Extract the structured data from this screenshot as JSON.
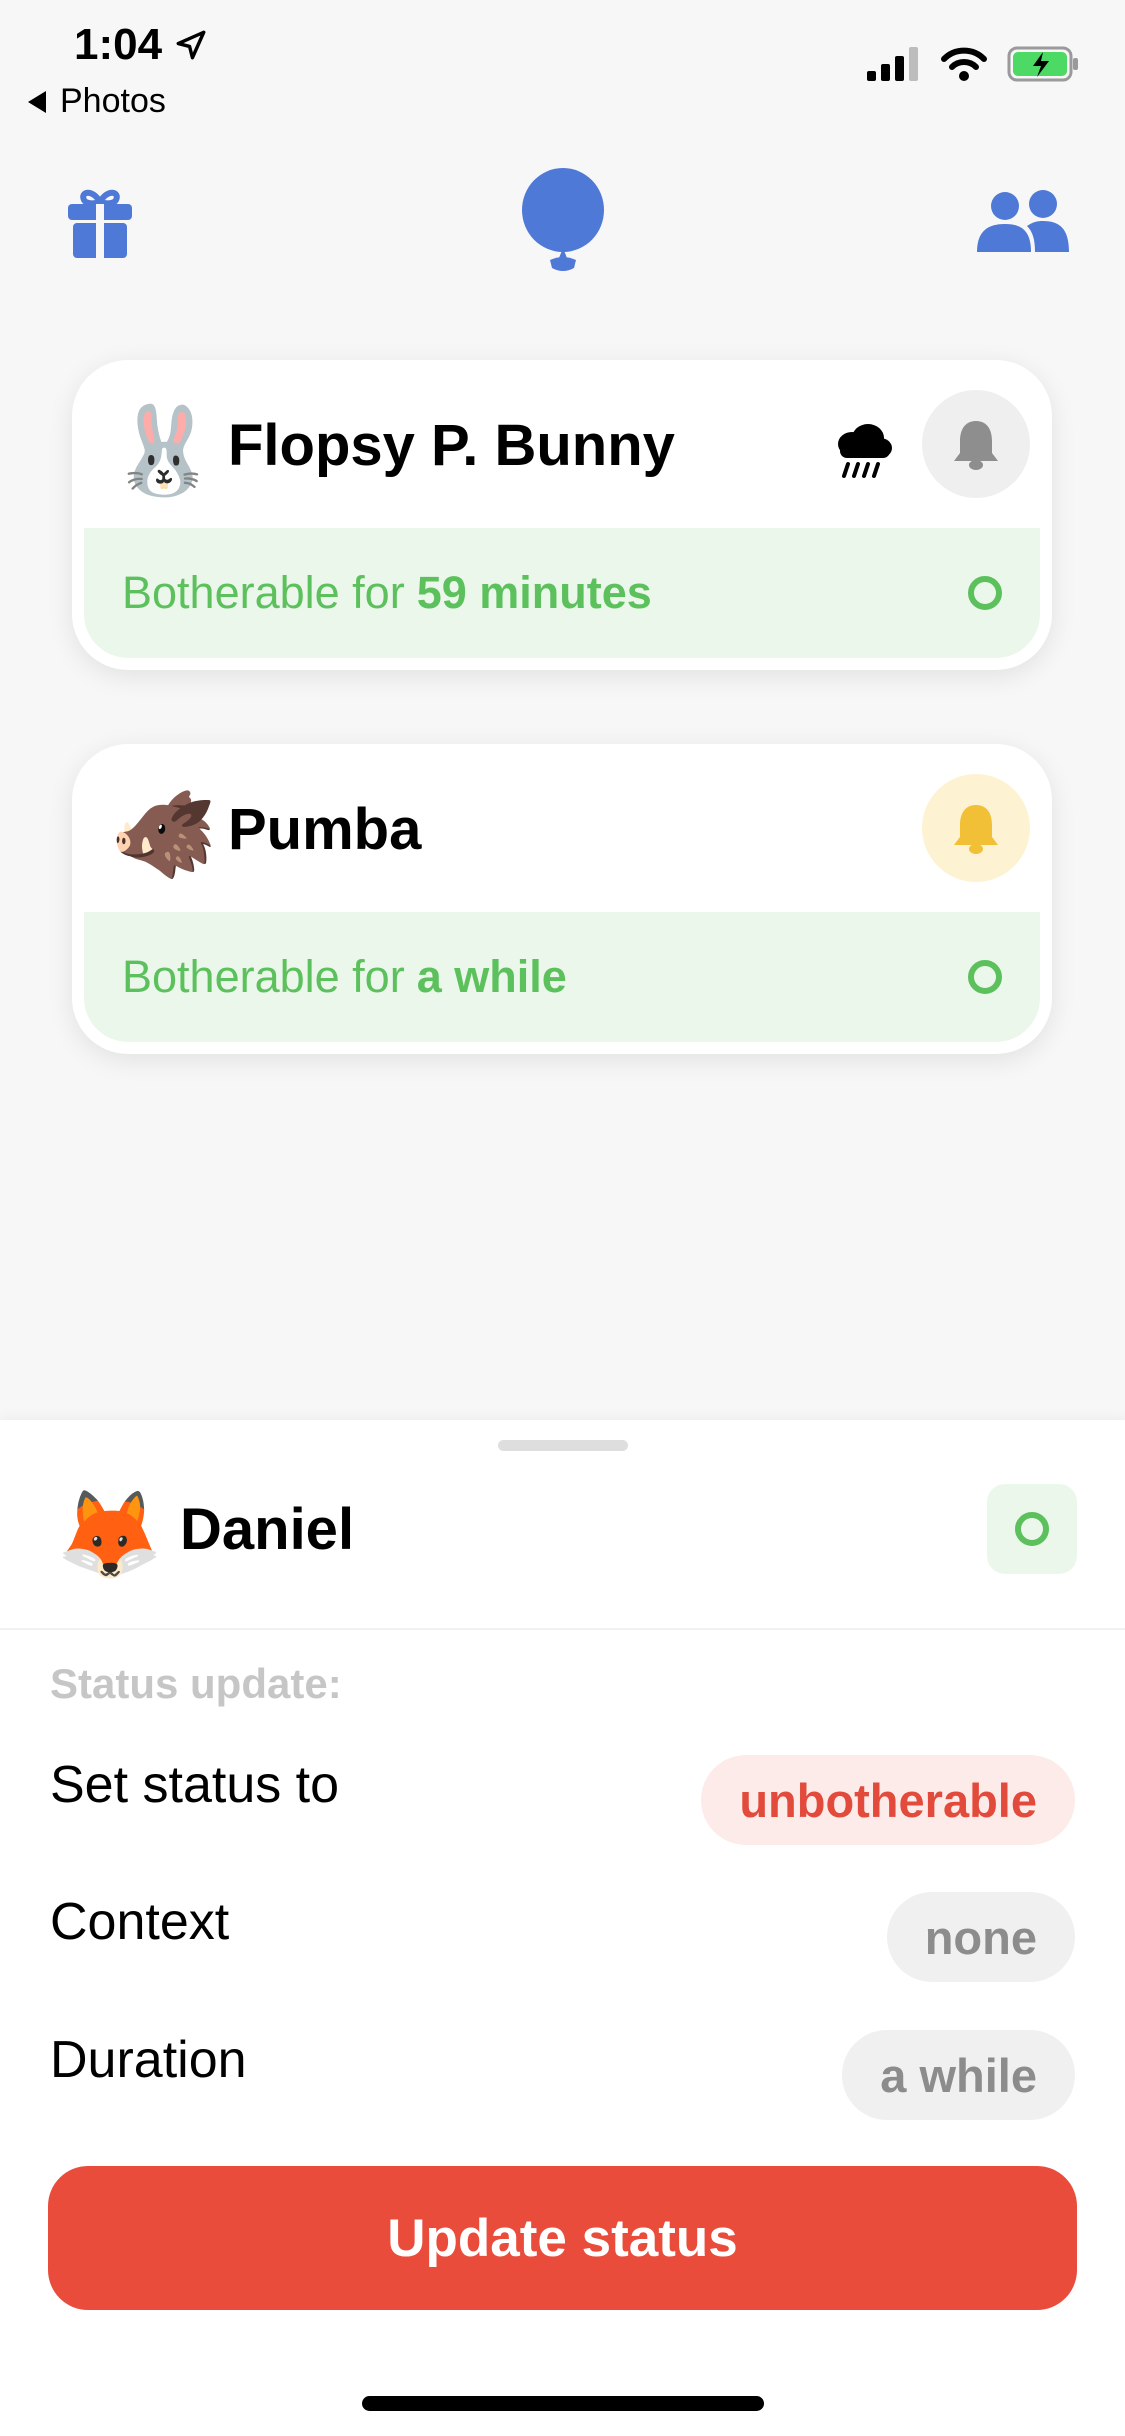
{
  "status_bar": {
    "time": "1:04",
    "back_label": "Photos",
    "icons": [
      "location-arrow-icon",
      "cellular-signal-icon",
      "wifi-icon",
      "battery-charging-icon"
    ]
  },
  "nav": {
    "icons": [
      "gift-icon",
      "balloon-icon",
      "people-icon"
    ],
    "accent_color": "#4f79d6"
  },
  "friends": [
    {
      "emoji": "🐰",
      "name": "Flopsy P. Bunny",
      "weather_icon": "rain-cloud-icon",
      "bell": "bell-grey",
      "status_prefix": "Botherable for",
      "status_value": "59 minutes"
    },
    {
      "emoji": "🐗",
      "name": "Pumba",
      "bell": "bell-yellow",
      "status_prefix": "Botherable for",
      "status_value": "a while"
    }
  ],
  "me": {
    "emoji": "🦊",
    "name": "Daniel"
  },
  "status_update": {
    "section_label": "Status update:",
    "set_status_label": "Set status to",
    "set_status_value": "unbotherable",
    "context_label": "Context",
    "context_value": "none",
    "duration_label": "Duration",
    "duration_value": "a while",
    "button_label": "Update status"
  },
  "colors": {
    "green": "#5cc15c",
    "green_bg": "#ecf7ec",
    "red": "#ea4c3c",
    "bell_yellow": "#f2c037"
  }
}
